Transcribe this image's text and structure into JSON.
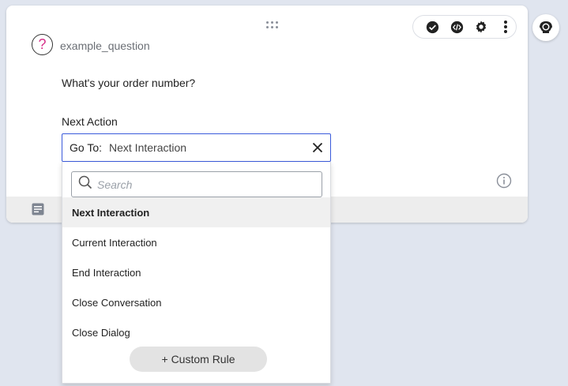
{
  "card": {
    "question_icon_glyph": "?",
    "question_name": "example_question",
    "prompt_text": "What's your order number?",
    "next_action_label": "Next Action"
  },
  "toolbar": {
    "icons": [
      "check-circle-icon",
      "code-icon",
      "gear-icon",
      "more-vertical-icon"
    ]
  },
  "select": {
    "prefix": "Go To:",
    "value": "Next Interaction"
  },
  "dropdown": {
    "search_placeholder": "Search",
    "options": [
      {
        "label": "Next Interaction",
        "selected": true
      },
      {
        "label": "Current Interaction",
        "selected": false
      },
      {
        "label": "End Interaction",
        "selected": false
      },
      {
        "label": "Close Conversation",
        "selected": false
      },
      {
        "label": "Close Dialog",
        "selected": false
      }
    ],
    "custom_rule_label": "+ Custom Rule"
  },
  "colors": {
    "accent_border": "#3b5bdb",
    "question_mark": "#d6338a",
    "background": "#e0e5ef"
  }
}
